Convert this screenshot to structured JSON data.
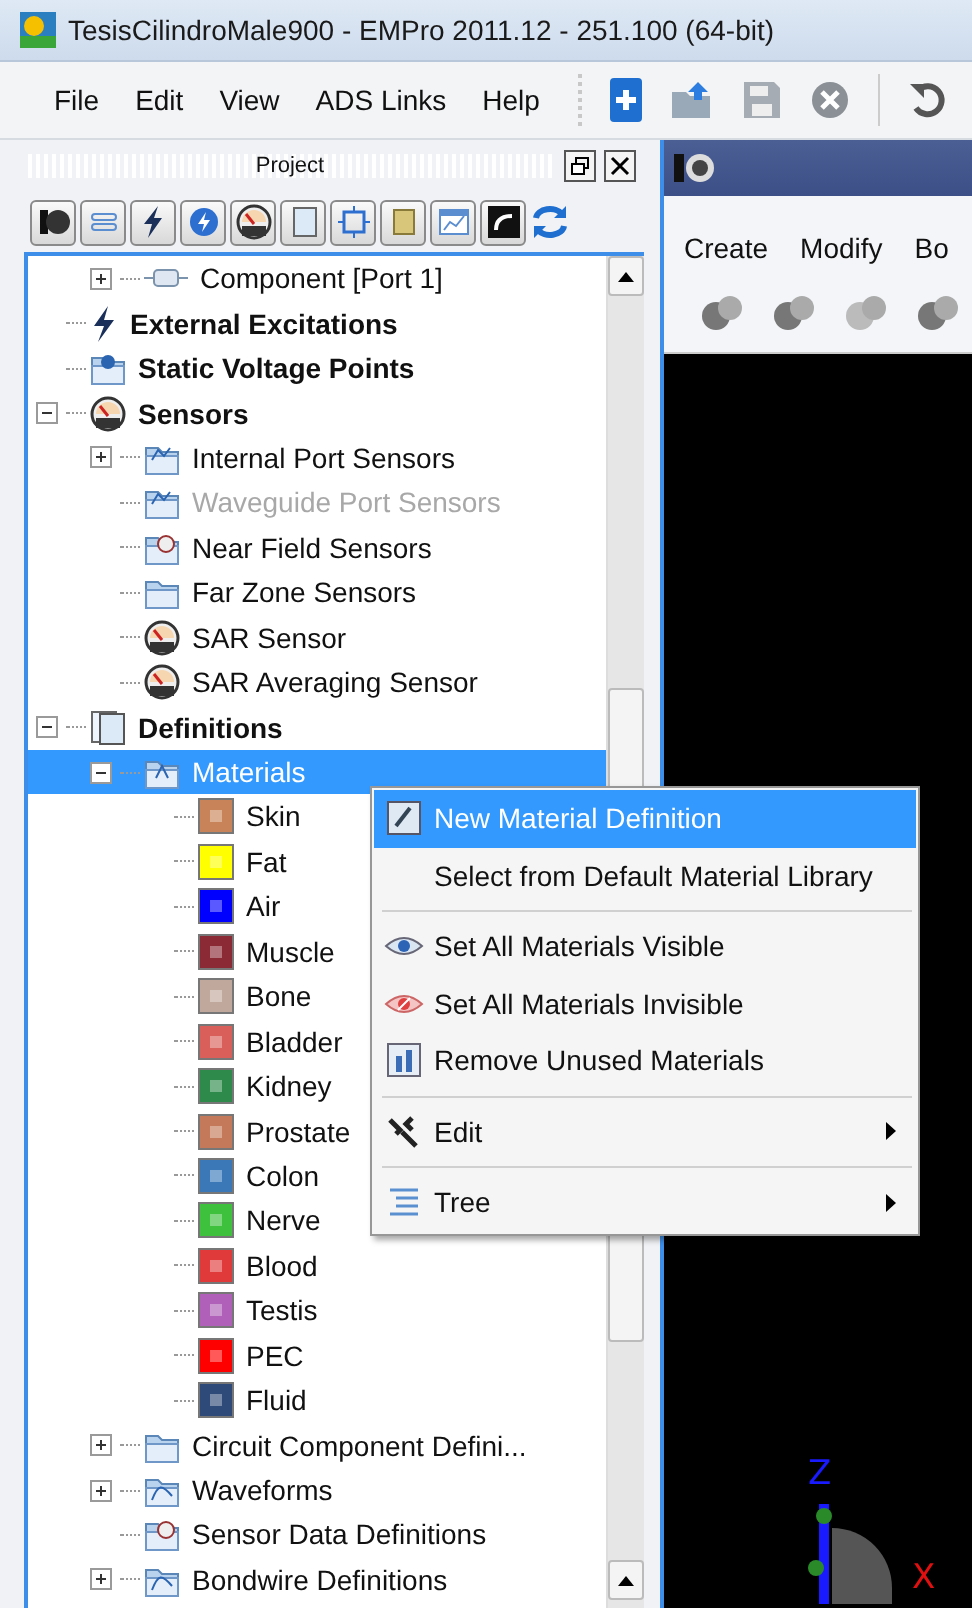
{
  "window": {
    "title": "TesisCilindroMale900 - EMPro 2011.12 - 251.100 (64-bit)"
  },
  "menu_bar": [
    "File",
    "Edit",
    "View",
    "ADS Links",
    "Help"
  ],
  "project_panel": {
    "title": "Project",
    "tree": [
      {
        "children": [
          {
            "label": "Component [Port 1]",
            "kind": "component",
            "expanded": false
          }
        ]
      },
      {
        "label": "External Excitations",
        "kind": "excitation",
        "bold": true
      },
      {
        "label": "Static Voltage Points",
        "kind": "voltage",
        "bold": true
      },
      {
        "label": "Sensors",
        "kind": "gauge",
        "bold": true,
        "expanded": true,
        "children": [
          {
            "label": "Internal Port Sensors",
            "kind": "sensor-folder",
            "expanded": false
          },
          {
            "label": "Waveguide Port Sensors",
            "kind": "sensor-folder",
            "disabled": true
          },
          {
            "label": "Near Field Sensors",
            "kind": "gauge-folder"
          },
          {
            "label": "Far Zone Sensors",
            "kind": "folder"
          },
          {
            "label": "SAR Sensor",
            "kind": "gauge"
          },
          {
            "label": "SAR Averaging Sensor",
            "kind": "gauge"
          }
        ]
      },
      {
        "label": "Definitions",
        "kind": "definitions",
        "bold": true,
        "expanded": true,
        "children": [
          {
            "label": "Materials",
            "kind": "materials",
            "selected": true,
            "expanded": true,
            "children": [
              {
                "label": "Skin",
                "kind": "material",
                "color": "#c98358"
              },
              {
                "label": "Fat",
                "kind": "material",
                "color": "#ffff00"
              },
              {
                "label": "Air",
                "kind": "material",
                "color": "#0000ff"
              },
              {
                "label": "Muscle",
                "kind": "material",
                "color": "#8b2a35"
              },
              {
                "label": "Bone",
                "kind": "material",
                "color": "#c0a89c"
              },
              {
                "label": "Bladder",
                "kind": "material",
                "color": "#d9605a"
              },
              {
                "label": "Kidney",
                "kind": "material",
                "color": "#2e8a4a"
              },
              {
                "label": "Prostate",
                "kind": "material",
                "color": "#c47a5a"
              },
              {
                "label": "Colon",
                "kind": "material",
                "color": "#3a78b8"
              },
              {
                "label": "Nerve",
                "kind": "material",
                "color": "#3ec23e"
              },
              {
                "label": "Blood",
                "kind": "material",
                "color": "#e03a3a"
              },
              {
                "label": "Testis",
                "kind": "material",
                "color": "#b060b8"
              },
              {
                "label": "PEC",
                "kind": "material",
                "color": "#ff0000"
              },
              {
                "label": "Fluid",
                "kind": "material",
                "color": "#2e4a78"
              }
            ]
          },
          {
            "label": "Circuit Component Defini...",
            "kind": "folder",
            "expanded": false
          },
          {
            "label": "Waveforms",
            "kind": "wave-folder",
            "expanded": false
          },
          {
            "label": "Sensor Data Definitions",
            "kind": "gauge-folder"
          },
          {
            "label": "Bondwire Definitions",
            "kind": "wave-folder",
            "expanded": false
          }
        ]
      }
    ]
  },
  "context_menu": [
    {
      "kind": "material",
      "label": "New Material Definition",
      "selected": true
    },
    {
      "kind": "plain",
      "label": "Select from Default Material Library",
      "selected": false
    },
    {
      "kind": "separator"
    },
    {
      "kind": "visible",
      "label": "Set All Materials Visible",
      "selected": false
    },
    {
      "kind": "invisible",
      "label": "Set All Materials Invisible",
      "selected": false
    },
    {
      "kind": "cleanup",
      "label": "Remove Unused Materials",
      "selected": false
    },
    {
      "kind": "separator"
    },
    {
      "kind": "wrench",
      "label": "Edit",
      "submenu": true,
      "selected": false
    },
    {
      "kind": "separator"
    },
    {
      "kind": "tree",
      "label": "Tree",
      "submenu": true,
      "selected": false
    }
  ],
  "view": {
    "menu": [
      "Create",
      "Modify",
      "Bo"
    ],
    "axes": [
      {
        "label": "Z",
        "color": "#1a1aff"
      },
      {
        "label": "X",
        "color": "#e01010"
      }
    ]
  }
}
